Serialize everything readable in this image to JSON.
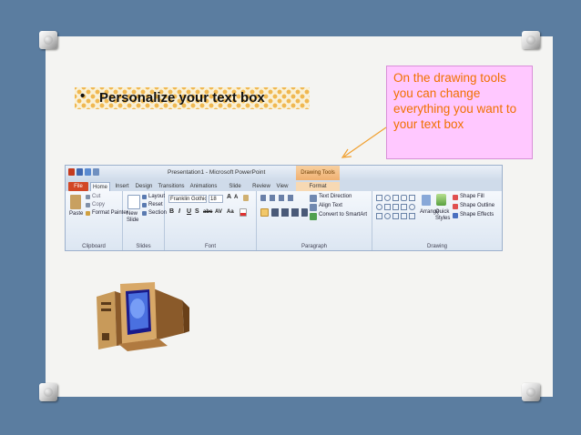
{
  "bullet": {
    "marker": "•",
    "text": "Personalize your text box"
  },
  "callout": {
    "text": "On the drawing tools you can change everything you want to your text box"
  },
  "ribbon": {
    "window_title": "Presentation1 - Microsoft PowerPoint",
    "contextual_label": "Drawing Tools",
    "tabs": [
      "File",
      "Home",
      "Insert",
      "Design",
      "Transitions",
      "Animations",
      "Slide Show",
      "Review",
      "View",
      "Format"
    ],
    "clipboard": {
      "paste": "Paste",
      "cut": "Cut",
      "copy": "Copy",
      "format_painter": "Format Painter",
      "label": "Clipboard"
    },
    "slides": {
      "new_slide": "New Slide",
      "layout": "Layout",
      "reset": "Reset",
      "section": "Section",
      "label": "Slides"
    },
    "font": {
      "name": "Franklin Gothic B",
      "size": "18",
      "label": "Font",
      "bold": "B",
      "italic": "I",
      "underline": "U",
      "strike": "S",
      "shadow": "abc",
      "spacing": "AV",
      "case": "Aa",
      "grow": "A",
      "shrink": "A"
    },
    "paragraph": {
      "text_direction": "Text Direction",
      "align_text": "Align Text",
      "smartart": "Convert to SmartArt",
      "label": "Paragraph"
    },
    "drawing": {
      "arrange": "Arrange",
      "quick_styles": "Quick Styles",
      "shape_fill": "Shape Fill",
      "shape_outline": "Shape Outline",
      "shape_effects": "Shape Effects",
      "label": "Drawing"
    }
  },
  "colors": {
    "background": "#5b7da0",
    "card": "#f4f4f2",
    "callout_fill": "#ffc8ff",
    "callout_text": "#f07000",
    "arrow": "#f0a030"
  },
  "icons": {
    "pins": "thumbtack-icon",
    "computer": "desktop-computer-icon"
  }
}
